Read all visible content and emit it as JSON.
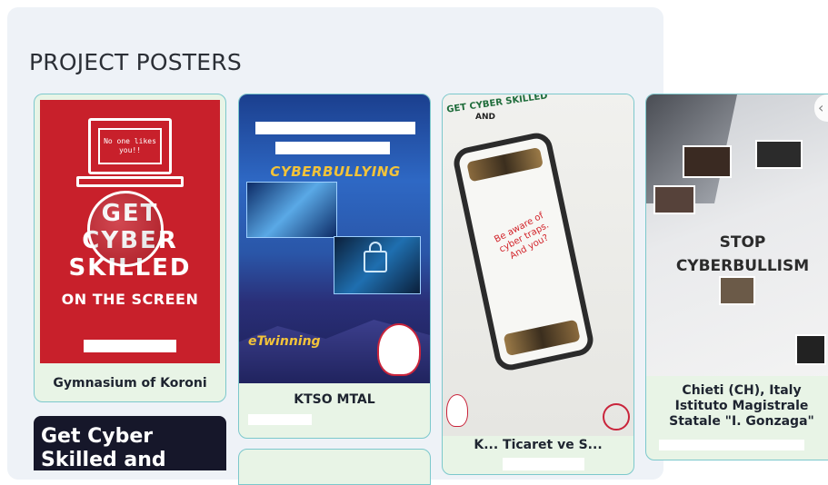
{
  "section": {
    "title": "PROJECT POSTERS"
  },
  "posters": [
    {
      "caption": "Gymnasium of Koroni",
      "screen_text": "No one likes you!!",
      "big_text": "GET CYBER SKILLED",
      "bottom_text": "ON THE SCREEN"
    },
    {
      "caption": "KTSO MTAL",
      "title_text": "CYBERBULLYING",
      "logo_text": "eTwinning"
    },
    {
      "top_text": "GET CYBER SKILLED",
      "and_text": "AND",
      "message": "Be aware of cyber traps. And you?",
      "caption_partial": "K... Ticaret ve S..."
    },
    {
      "stop_line1": "STOP",
      "stop_line2": "CYBERBULLISM",
      "caption": "Chieti (CH), Italy Istituto Magistrale Statale \"I. Gonzaga\""
    },
    {
      "title": "Get Cyber Skilled and Prevent"
    }
  ],
  "colors": {
    "panel_bg": "#eef2f7",
    "card_bg": "#e8f4e6",
    "card_border": "#7cc8cc",
    "poster1_red": "#c8202b"
  }
}
